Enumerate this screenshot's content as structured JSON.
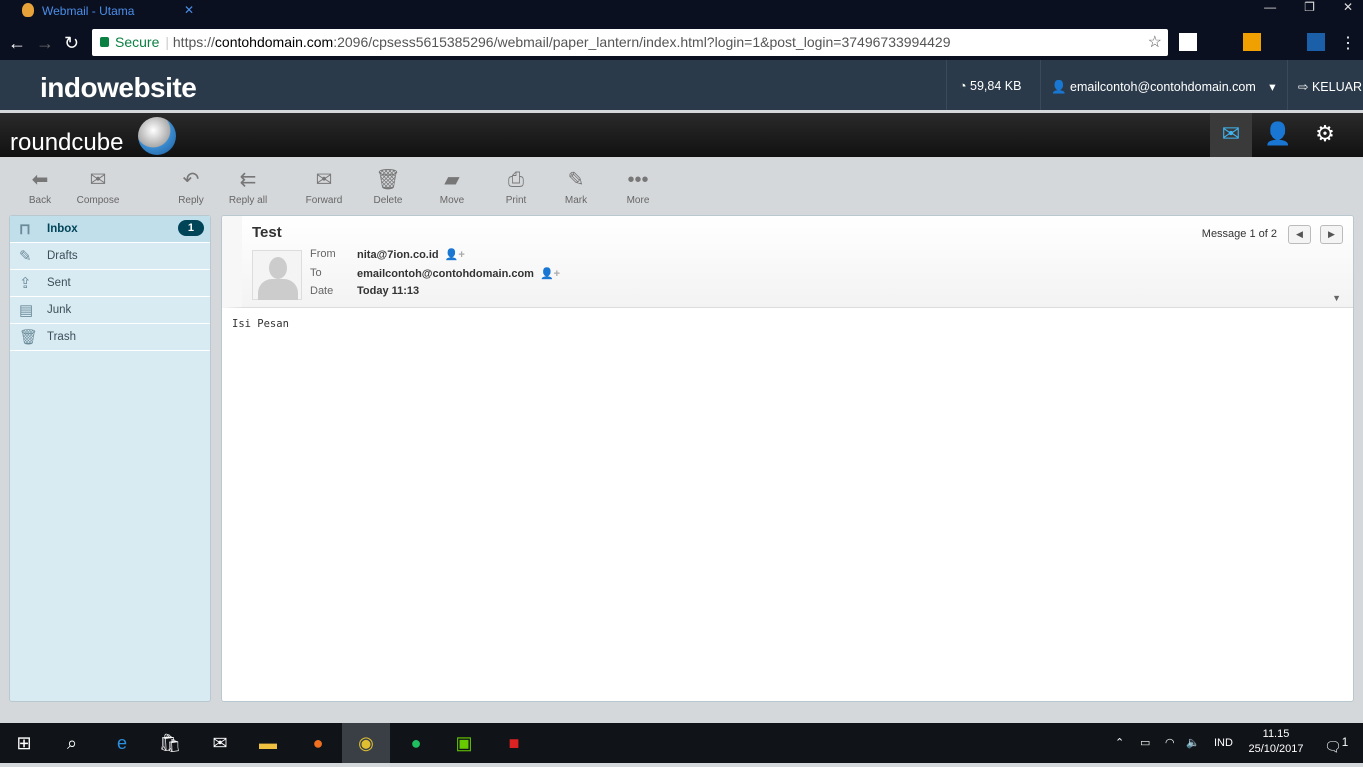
{
  "browser": {
    "tab_title": "Webmail - Utama",
    "secure_label": "Secure",
    "url_scheme": "https://",
    "url_host": "contohdomain.com",
    "url_rest": ":2096/cpsess5615385296/webmail/paper_lantern/index.html?login=1&post_login=37496733994429"
  },
  "cpanel": {
    "logo": "indowebsite",
    "disk_usage": "59,84 KB",
    "account": "emailcontoh@contohdomain.com",
    "logout": "KELUAR"
  },
  "roundcube": {
    "logo": "roundcube"
  },
  "toolbar": [
    {
      "label": "Back",
      "icon": "back-arrow-icon"
    },
    {
      "label": "Compose",
      "icon": "compose-icon"
    },
    {
      "label": "Reply",
      "icon": "reply-icon"
    },
    {
      "label": "Reply all",
      "icon": "reply-all-icon"
    },
    {
      "label": "Forward",
      "icon": "forward-icon"
    },
    {
      "label": "Delete",
      "icon": "trash-icon"
    },
    {
      "label": "Move",
      "icon": "folder-move-icon"
    },
    {
      "label": "Print",
      "icon": "printer-icon"
    },
    {
      "label": "Mark",
      "icon": "pen-icon"
    },
    {
      "label": "More",
      "icon": "more-dots-icon"
    }
  ],
  "folders": [
    {
      "label": "Inbox",
      "count": "1",
      "icon": "inbox-icon"
    },
    {
      "label": "Drafts",
      "icon": "pencil-icon"
    },
    {
      "label": "Sent",
      "icon": "sent-icon"
    },
    {
      "label": "Junk",
      "icon": "junk-icon"
    },
    {
      "label": "Trash",
      "icon": "trash-icon"
    }
  ],
  "message": {
    "subject": "Test",
    "from_label": "From",
    "from": "nita@7ion.co.id",
    "to_label": "To",
    "to": "emailcontoh@contohdomain.com",
    "date_label": "Date",
    "date": "Today 11:13",
    "counter": "Message 1 of 2",
    "body": "Isi Pesan"
  },
  "taskbar": {
    "lang": "IND",
    "time": "11.15",
    "date": "25/10/2017",
    "notifications": "1"
  }
}
